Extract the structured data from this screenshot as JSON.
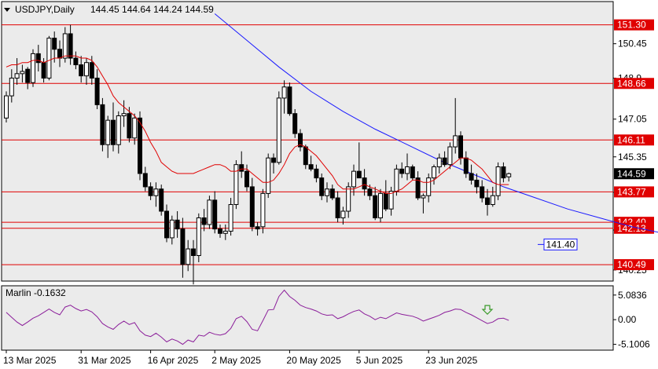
{
  "header": {
    "symbol": "USDJPY,Daily",
    "ohlc": "144.45 144.64 144.24 144.59"
  },
  "indicator": {
    "name_value": "Marlin -0.1632",
    "ticks": [
      "5.0836",
      "0.00",
      "-5.1006"
    ],
    "tick_values": [
      5.0836,
      0,
      -5.1006
    ]
  },
  "colors": {
    "background": "#ffffff",
    "plot_bg": "#ebebeb",
    "candle": "#000000",
    "ma_red": "#e00000",
    "ma_blue": "#1a1aff",
    "level_line": "#e00000",
    "level_label_bg": "#e00000",
    "current_price_bg": "#000000",
    "marlin_line": "#8b1e9a",
    "signal_arrow": "#3a9a2a",
    "blue_label": "#1a1aff"
  },
  "chart_data": {
    "type": "candlestick",
    "y_ticks": [
      150.45,
      148.9,
      147.05,
      145.35,
      143.75,
      142.05,
      140.25
    ],
    "y_tick_labels": [
      "150.45",
      "148.9",
      "147.05",
      "145.35",
      "143.75",
      "142.05",
      "140.25"
    ],
    "x_labels": [
      "13 Mar 2025",
      "31 Mar 2025",
      "16 Apr 2025",
      "2 May 2025",
      "20 May 2025",
      "5 Jun 2025",
      "23 Jun 2025"
    ],
    "levels": [
      {
        "value": 151.3,
        "label": "151.30"
      },
      {
        "value": 148.66,
        "label": "148.66"
      },
      {
        "value": 146.11,
        "label": "146.11"
      },
      {
        "value": 143.77,
        "label": "143.77"
      },
      {
        "value": 142.4,
        "label": "142.40"
      },
      {
        "value": 142.13,
        "label": "142.13"
      },
      {
        "value": 140.49,
        "label": "140.49"
      }
    ],
    "current_price": {
      "value": 144.59,
      "label": "144.59"
    },
    "blue_ma_label": {
      "value": 141.4,
      "label": "141.40"
    },
    "candles": [
      [
        147.1,
        148.3,
        146.9,
        148.1
      ],
      [
        148.1,
        149.3,
        147.8,
        148.9
      ],
      [
        148.9,
        149.8,
        148.6,
        149.1
      ],
      [
        149.1,
        149.5,
        148.7,
        149.2
      ],
      [
        149.3,
        149.4,
        148.4,
        148.7
      ],
      [
        148.7,
        150.2,
        148.5,
        150.0
      ],
      [
        150.0,
        150.4,
        149.2,
        149.6
      ],
      [
        149.6,
        149.8,
        148.7,
        148.9
      ],
      [
        148.9,
        150.8,
        148.8,
        150.7
      ],
      [
        150.7,
        151.0,
        149.6,
        150.2
      ],
      [
        150.2,
        150.6,
        149.4,
        149.8
      ],
      [
        149.8,
        151.2,
        149.6,
        150.9
      ],
      [
        150.9,
        151.3,
        149.5,
        149.8
      ],
      [
        149.8,
        150.1,
        149.3,
        149.5
      ],
      [
        149.5,
        149.9,
        148.7,
        149.0
      ],
      [
        149.0,
        149.8,
        148.6,
        149.6
      ],
      [
        149.6,
        149.9,
        148.6,
        148.9
      ],
      [
        148.9,
        149.3,
        147.5,
        147.7
      ],
      [
        147.7,
        148.0,
        145.6,
        145.9
      ],
      [
        145.9,
        147.2,
        145.3,
        147.0
      ],
      [
        147.0,
        147.8,
        145.6,
        145.9
      ],
      [
        145.9,
        147.4,
        145.5,
        147.2
      ],
      [
        147.2,
        147.9,
        146.7,
        147.3
      ],
      [
        147.3,
        147.6,
        146.0,
        146.2
      ],
      [
        146.2,
        147.3,
        145.9,
        147.1
      ],
      [
        147.1,
        147.4,
        144.3,
        144.6
      ],
      [
        144.6,
        144.9,
        143.8,
        144.0
      ],
      [
        144.0,
        144.2,
        143.4,
        143.6
      ],
      [
        143.6,
        144.2,
        143.1,
        143.9
      ],
      [
        143.9,
        144.1,
        142.7,
        142.9
      ],
      [
        142.9,
        143.2,
        141.5,
        141.7
      ],
      [
        141.7,
        142.7,
        141.4,
        142.5
      ],
      [
        142.5,
        142.9,
        141.7,
        142.1
      ],
      [
        142.1,
        142.6,
        139.9,
        140.5
      ],
      [
        140.5,
        141.6,
        140.2,
        141.2
      ],
      [
        141.2,
        141.6,
        139.6,
        140.9
      ],
      [
        140.9,
        142.8,
        140.6,
        142.6
      ],
      [
        142.6,
        143.0,
        142.0,
        142.3
      ],
      [
        142.3,
        143.6,
        142.1,
        143.4
      ],
      [
        143.4,
        143.8,
        141.9,
        142.1
      ],
      [
        142.1,
        142.3,
        141.7,
        141.9
      ],
      [
        141.9,
        142.3,
        141.6,
        142.0
      ],
      [
        142.0,
        143.5,
        141.8,
        143.2
      ],
      [
        143.2,
        145.2,
        143.0,
        145.0
      ],
      [
        145.0,
        145.6,
        144.4,
        144.7
      ],
      [
        144.7,
        145.0,
        143.8,
        144.0
      ],
      [
        144.0,
        144.4,
        142.0,
        142.2
      ],
      [
        142.2,
        142.4,
        141.8,
        142.1
      ],
      [
        142.2,
        143.9,
        141.9,
        143.7
      ],
      [
        143.7,
        145.5,
        143.5,
        145.3
      ],
      [
        145.3,
        145.5,
        144.6,
        145.1
      ],
      [
        145.1,
        148.3,
        145.0,
        148.0
      ],
      [
        148.0,
        148.8,
        147.3,
        148.5
      ],
      [
        148.5,
        148.7,
        147.2,
        147.3
      ],
      [
        147.3,
        147.5,
        146.2,
        146.4
      ],
      [
        146.4,
        146.6,
        145.6,
        145.8
      ],
      [
        145.8,
        145.9,
        144.8,
        145.0
      ],
      [
        145.0,
        145.4,
        144.7,
        144.8
      ],
      [
        144.8,
        145.0,
        144.2,
        144.4
      ],
      [
        144.4,
        144.6,
        143.4,
        143.6
      ],
      [
        143.6,
        144.2,
        143.3,
        143.9
      ],
      [
        143.9,
        144.1,
        143.4,
        143.5
      ],
      [
        143.5,
        143.8,
        142.4,
        142.6
      ],
      [
        142.6,
        143.1,
        142.3,
        142.9
      ],
      [
        142.9,
        144.2,
        142.6,
        144.0
      ],
      [
        144.0,
        145.0,
        143.6,
        144.7
      ],
      [
        144.7,
        146.0,
        144.4,
        144.4
      ],
      [
        144.4,
        144.8,
        143.6,
        143.9
      ],
      [
        143.9,
        144.1,
        143.4,
        143.6
      ],
      [
        143.6,
        144.0,
        142.5,
        142.6
      ],
      [
        142.6,
        143.9,
        142.4,
        143.7
      ],
      [
        143.7,
        144.3,
        142.9,
        143.0
      ],
      [
        143.0,
        144.0,
        142.7,
        143.8
      ],
      [
        143.8,
        145.0,
        143.6,
        144.8
      ],
      [
        144.8,
        145.1,
        144.4,
        144.6
      ],
      [
        144.6,
        145.5,
        144.3,
        144.9
      ],
      [
        144.9,
        145.0,
        144.3,
        144.4
      ],
      [
        144.4,
        144.7,
        143.4,
        143.5
      ],
      [
        143.5,
        143.7,
        142.8,
        143.6
      ],
      [
        143.6,
        144.6,
        143.3,
        144.4
      ],
      [
        144.4,
        145.0,
        144.1,
        144.9
      ],
      [
        144.9,
        145.5,
        144.6,
        145.3
      ],
      [
        145.3,
        145.6,
        144.9,
        145.0
      ],
      [
        145.0,
        146.0,
        144.8,
        145.8
      ],
      [
        145.8,
        148.0,
        145.5,
        146.3
      ],
      [
        146.3,
        146.5,
        145.0,
        145.3
      ],
      [
        145.3,
        145.6,
        144.4,
        144.6
      ],
      [
        144.6,
        145.0,
        144.1,
        144.3
      ],
      [
        144.3,
        144.6,
        143.7,
        144.0
      ],
      [
        144.0,
        144.3,
        143.3,
        143.5
      ],
      [
        143.5,
        143.9,
        142.7,
        143.2
      ],
      [
        143.2,
        144.0,
        143.1,
        143.6
      ],
      [
        143.6,
        145.1,
        143.4,
        144.9
      ],
      [
        144.9,
        145.1,
        144.2,
        144.4
      ],
      [
        144.45,
        144.64,
        144.24,
        144.59
      ]
    ],
    "red_ma": [
      149.4,
      149.5,
      149.5,
      149.6,
      149.6,
      149.7,
      149.7,
      149.6,
      149.7,
      149.8,
      149.8,
      149.9,
      149.9,
      149.9,
      149.8,
      149.8,
      149.7,
      149.4,
      149.0,
      148.6,
      148.1,
      147.8,
      147.6,
      147.4,
      147.2,
      146.9,
      146.5,
      146.0,
      145.6,
      145.1,
      144.9,
      144.7,
      144.6,
      144.6,
      144.6,
      144.6,
      144.7,
      144.8,
      144.9,
      145.0,
      145.0,
      144.9,
      144.7,
      144.7,
      144.8,
      144.8,
      144.6,
      144.4,
      144.2,
      144.2,
      144.3,
      144.6,
      145.0,
      145.5,
      145.8,
      145.9,
      145.8,
      145.6,
      145.4,
      145.1,
      144.8,
      144.5,
      144.1,
      143.9,
      143.9,
      143.9,
      144.0,
      144.1,
      144.0,
      143.9,
      143.8,
      143.7,
      143.7,
      143.8,
      143.9,
      144.1,
      144.3,
      144.3,
      144.2,
      144.2,
      144.3,
      144.5,
      144.7,
      144.9,
      145.1,
      145.3,
      145.3,
      145.2,
      145.0,
      144.8,
      144.5,
      144.2,
      144.1,
      144.1,
      144.1
    ],
    "blue_ma": [
      {
        "i": 39,
        "v": 151.8
      },
      {
        "i": 45,
        "v": 150.6
      },
      {
        "i": 51,
        "v": 149.4
      },
      {
        "i": 57,
        "v": 148.3
      },
      {
        "i": 63,
        "v": 147.4
      },
      {
        "i": 69,
        "v": 146.6
      },
      {
        "i": 75,
        "v": 145.9
      },
      {
        "i": 81,
        "v": 145.2
      },
      {
        "i": 87,
        "v": 144.6
      },
      {
        "i": 93,
        "v": 144.0
      },
      {
        "i": 99,
        "v": 143.5
      },
      {
        "i": 105,
        "v": 143.0
      },
      {
        "i": 111,
        "v": 142.6
      },
      {
        "i": 117,
        "v": 142.2
      },
      {
        "i": 123,
        "v": 141.9
      },
      {
        "i": 129,
        "v": 141.7
      },
      {
        "i": 135,
        "v": 141.55
      },
      {
        "i": 141,
        "v": 141.45
      },
      {
        "i": 146,
        "v": 141.4
      }
    ],
    "marlin": [
      1.5,
      0.5,
      -0.5,
      -1.2,
      -0.5,
      0.3,
      0.8,
      1.5,
      2.2,
      1.5,
      1.0,
      2.6,
      3.0,
      2.3,
      1.8,
      2.1,
      1.6,
      0.6,
      -0.8,
      -1.5,
      -2.0,
      -1.0,
      -0.3,
      -1.0,
      -0.6,
      -2.3,
      -3.2,
      -3.5,
      -2.8,
      -3.6,
      -4.6,
      -4.0,
      -4.4,
      -5.1,
      -4.2,
      -4.6,
      -3.2,
      -3.4,
      -2.6,
      -3.0,
      -3.2,
      -2.9,
      -1.8,
      0.2,
      0.7,
      -0.4,
      -2.0,
      -2.3,
      -0.2,
      2.0,
      2.1,
      4.8,
      6.1,
      4.8,
      4.0,
      3.0,
      2.5,
      2.2,
      1.8,
      1.2,
      0.9,
      1.0,
      0.2,
      0.6,
      1.2,
      1.7,
      2.0,
      1.2,
      0.7,
      0.0,
      0.5,
      0.2,
      0.8,
      1.4,
      1.1,
      0.9,
      0.7,
      0.3,
      -0.3,
      0.1,
      0.5,
      0.9,
      1.5,
      1.8,
      2.2,
      2.1,
      1.5,
      1.0,
      0.4,
      -0.2,
      -0.8,
      -0.5,
      0.2,
      0.3,
      -0.16
    ]
  }
}
